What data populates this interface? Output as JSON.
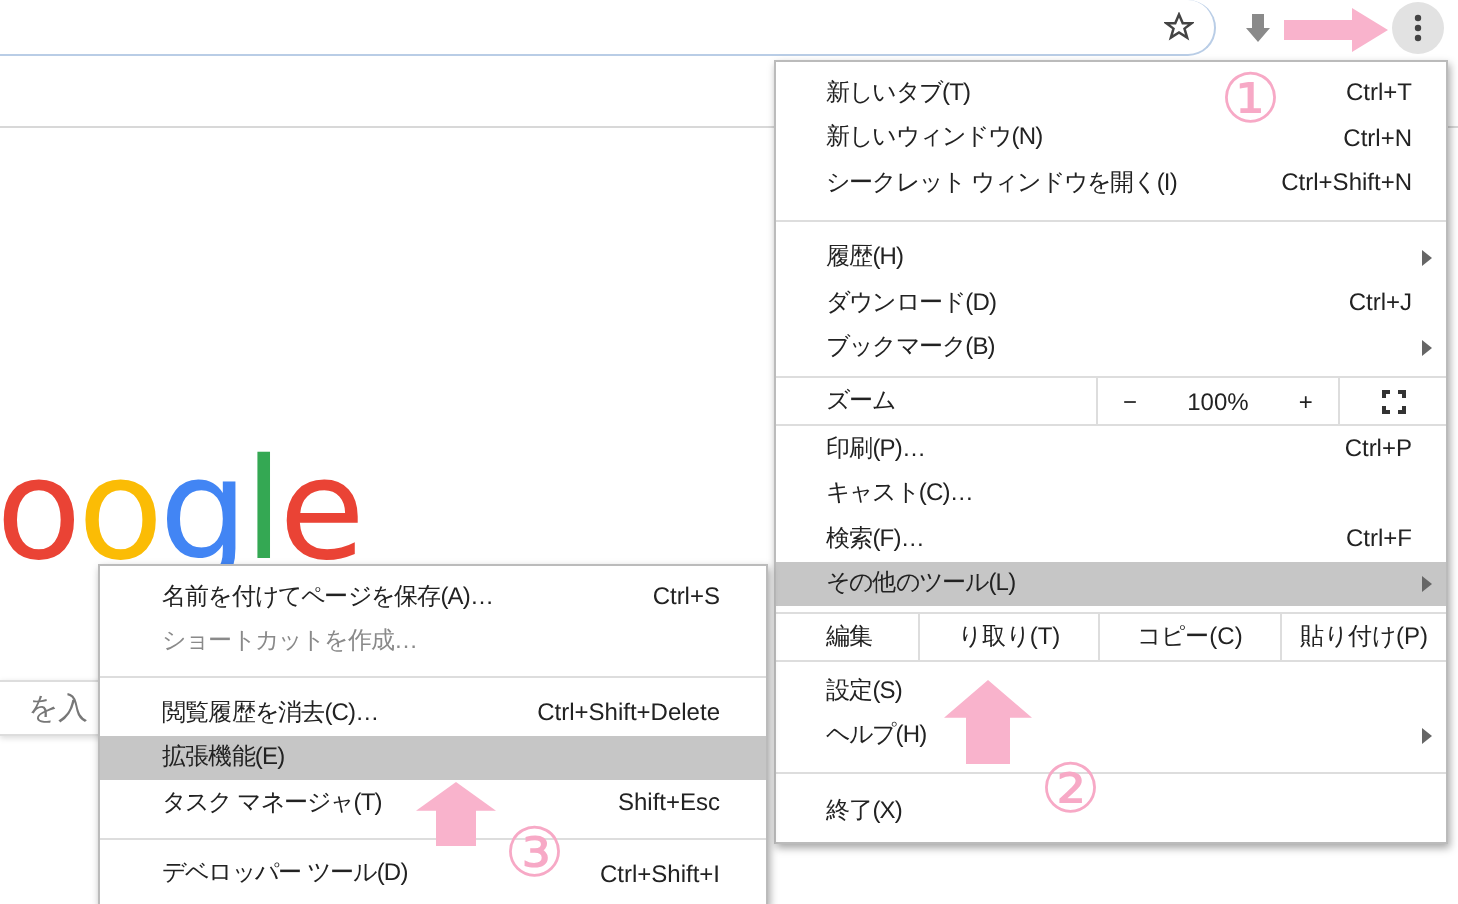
{
  "logo": [
    {
      "text": "o",
      "color": "#ea4335"
    },
    {
      "text": "o",
      "color": "#fbbc05"
    },
    {
      "text": "g",
      "color": "#4285f4"
    },
    {
      "text": "l",
      "color": "#34a853"
    },
    {
      "text": "e",
      "color": "#ea4335"
    }
  ],
  "search": {
    "placeholder": "を入"
  },
  "menu": {
    "items": [
      {
        "kind": "item",
        "label": "新しいタブ(T)",
        "shortcut": "Ctrl+T",
        "submenu": false,
        "selected": false
      },
      {
        "kind": "item",
        "label": "新しいウィンドウ(N)",
        "shortcut": "Ctrl+N",
        "submenu": false,
        "selected": false
      },
      {
        "kind": "item",
        "label": "シークレット ウィンドウを開く(I)",
        "shortcut": "Ctrl+Shift+N",
        "submenu": false,
        "selected": false
      },
      {
        "kind": "separator"
      },
      {
        "kind": "item",
        "label": "履歴(H)",
        "submenu": true,
        "selected": false
      },
      {
        "kind": "item",
        "label": "ダウンロード(D)",
        "shortcut": "Ctrl+J",
        "submenu": false,
        "selected": false
      },
      {
        "kind": "item",
        "label": "ブックマーク(B)",
        "submenu": true,
        "selected": false
      },
      {
        "kind": "zoom",
        "label": "ズーム",
        "minus": "−",
        "level": "100%",
        "plus": "+"
      },
      {
        "kind": "item",
        "label": "印刷(P)…",
        "shortcut": "Ctrl+P",
        "submenu": false,
        "selected": false
      },
      {
        "kind": "item",
        "label": "キャスト(C)…",
        "submenu": false,
        "selected": false
      },
      {
        "kind": "item",
        "label": "検索(F)…",
        "shortcut": "Ctrl+F",
        "submenu": false,
        "selected": false
      },
      {
        "kind": "item",
        "label": "その他のツール(L)",
        "submenu": true,
        "selected": true
      },
      {
        "kind": "edit",
        "label": "編集",
        "cut": "り取り(T)",
        "copy": "コピー(C)",
        "paste": "貼り付け(P)"
      },
      {
        "kind": "item",
        "label": "設定(S)",
        "submenu": false,
        "selected": false
      },
      {
        "kind": "item",
        "label": "ヘルプ(H)",
        "submenu": true,
        "selected": false
      },
      {
        "kind": "separator"
      },
      {
        "kind": "item",
        "label": "終了(X)",
        "submenu": false,
        "selected": false
      }
    ]
  },
  "submenu": {
    "items": [
      {
        "kind": "item",
        "label": "名前を付けてページを保存(A)…",
        "shortcut": "Ctrl+S",
        "disabled": false,
        "selected": false
      },
      {
        "kind": "item",
        "label": "ショートカットを作成…",
        "disabled": true,
        "selected": false
      },
      {
        "kind": "separator"
      },
      {
        "kind": "item",
        "label": "閲覧履歴を消去(C)…",
        "shortcut": "Ctrl+Shift+Delete",
        "disabled": false,
        "selected": false
      },
      {
        "kind": "item",
        "label": "拡張機能(E)",
        "disabled": false,
        "selected": true
      },
      {
        "kind": "item",
        "label": "タスク マネージャ(T)",
        "shortcut": "Shift+Esc",
        "disabled": false,
        "selected": false
      },
      {
        "kind": "separator"
      },
      {
        "kind": "item",
        "label": "デベロッパー ツール(D)",
        "shortcut": "Ctrl+Shift+I",
        "disabled": false,
        "selected": false
      }
    ]
  },
  "annotations": [
    {
      "label": "①"
    },
    {
      "label": "②"
    },
    {
      "label": "③"
    }
  ]
}
